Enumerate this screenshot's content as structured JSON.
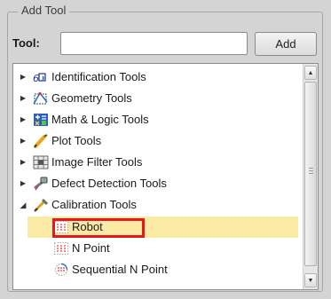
{
  "panel": {
    "title": "Add Tool",
    "tool_label": "Tool:",
    "tool_input_value": "",
    "add_button_label": "Add"
  },
  "tree": {
    "categories": [
      {
        "label": "Identification Tools",
        "expanded": false,
        "icon": "identification-icon"
      },
      {
        "label": "Geometry Tools",
        "expanded": false,
        "icon": "geometry-icon"
      },
      {
        "label": "Math & Logic Tools",
        "expanded": false,
        "icon": "math-logic-icon"
      },
      {
        "label": "Plot Tools",
        "expanded": false,
        "icon": "plot-icon"
      },
      {
        "label": "Image Filter Tools",
        "expanded": false,
        "icon": "image-filter-icon"
      },
      {
        "label": "Defect Detection Tools",
        "expanded": false,
        "icon": "defect-detection-icon"
      },
      {
        "label": "Calibration Tools",
        "expanded": true,
        "icon": "calibration-icon"
      }
    ],
    "calibration_children": [
      {
        "label": "Robot",
        "selected": true,
        "icon": "robot-calibration-icon"
      },
      {
        "label": "N Point",
        "selected": false,
        "icon": "n-point-icon"
      },
      {
        "label": "Sequential N Point",
        "selected": false,
        "icon": "sequential-n-point-icon"
      }
    ]
  },
  "colors": {
    "selection": "#fbeaa6",
    "highlight_box": "#e5191d"
  }
}
